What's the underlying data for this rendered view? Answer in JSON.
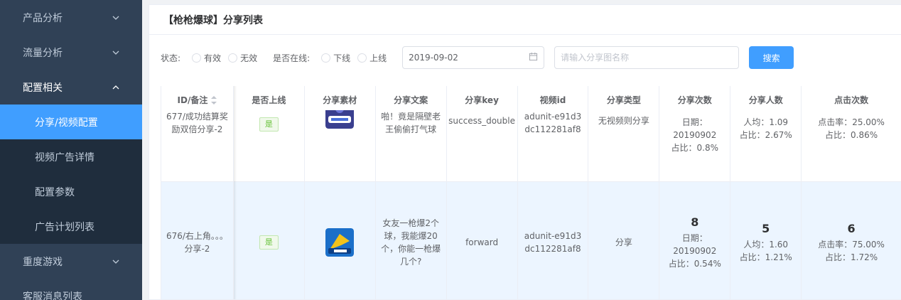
{
  "sidebar": {
    "items": [
      {
        "label": "产品分析"
      },
      {
        "label": "流量分析"
      },
      {
        "label": "配置相关"
      },
      {
        "label": "分享/视频配置"
      },
      {
        "label": "视频广告详情"
      },
      {
        "label": "配置参数"
      },
      {
        "label": "广告计划列表"
      },
      {
        "label": "重度游戏"
      },
      {
        "label": "客服消息列表"
      }
    ]
  },
  "card": {
    "title": "【枪枪爆球】分享列表"
  },
  "filters": {
    "status_label": "状态:",
    "status_options": [
      "有效",
      "无效"
    ],
    "online_label": "是否在线:",
    "online_options": [
      "下线",
      "上线"
    ],
    "date_value": "2019-09-02",
    "search_placeholder": "请输入分享图名称",
    "search_button": "搜索"
  },
  "table": {
    "columns": [
      "ID/备注",
      "是否上线",
      "分享素材",
      "分享文案",
      "分享key",
      "视频id",
      "分享类型",
      "分享次数",
      "分享人数",
      "点击次数"
    ],
    "rows": [
      {
        "id_note": "677/成功结算奖励双倍分享-2",
        "online": "是",
        "copy": "啪！竟是隔壁老王偷偷打气球",
        "key": "success_double",
        "video_id": "adunit-e91d3dc112281af8",
        "type": "无视频则分享",
        "share_count": {
          "date": "日期：20190902",
          "ratio": "占比：0.8%"
        },
        "share_users": {
          "avg": "人均：1.09",
          "ratio": "占比：2.67%"
        },
        "clicks": {
          "rate": "点击率：25.00%",
          "ratio": "占比：0.86%"
        }
      },
      {
        "id_note": "676/右上角。。。分享-2",
        "online": "是",
        "copy": "女友一枪爆2个球，我能爆20个，你能一枪爆几个?",
        "key": "forward",
        "video_id": "adunit-e91d3dc112281af8",
        "type": "分享",
        "share_count": {
          "value": "8",
          "date": "日期：20190902",
          "ratio": "占比：0.54%"
        },
        "share_users": {
          "value": "5",
          "avg": "人均：1.60",
          "ratio": "占比：1.21%"
        },
        "clicks": {
          "value": "6",
          "rate": "点击率：75.00%",
          "ratio": "占比：1.72%"
        }
      }
    ]
  },
  "colors": {
    "sidebar": "#304156",
    "active": "#409eff",
    "tag": "#67c23a",
    "row_highlight": "#ecf5ff"
  }
}
